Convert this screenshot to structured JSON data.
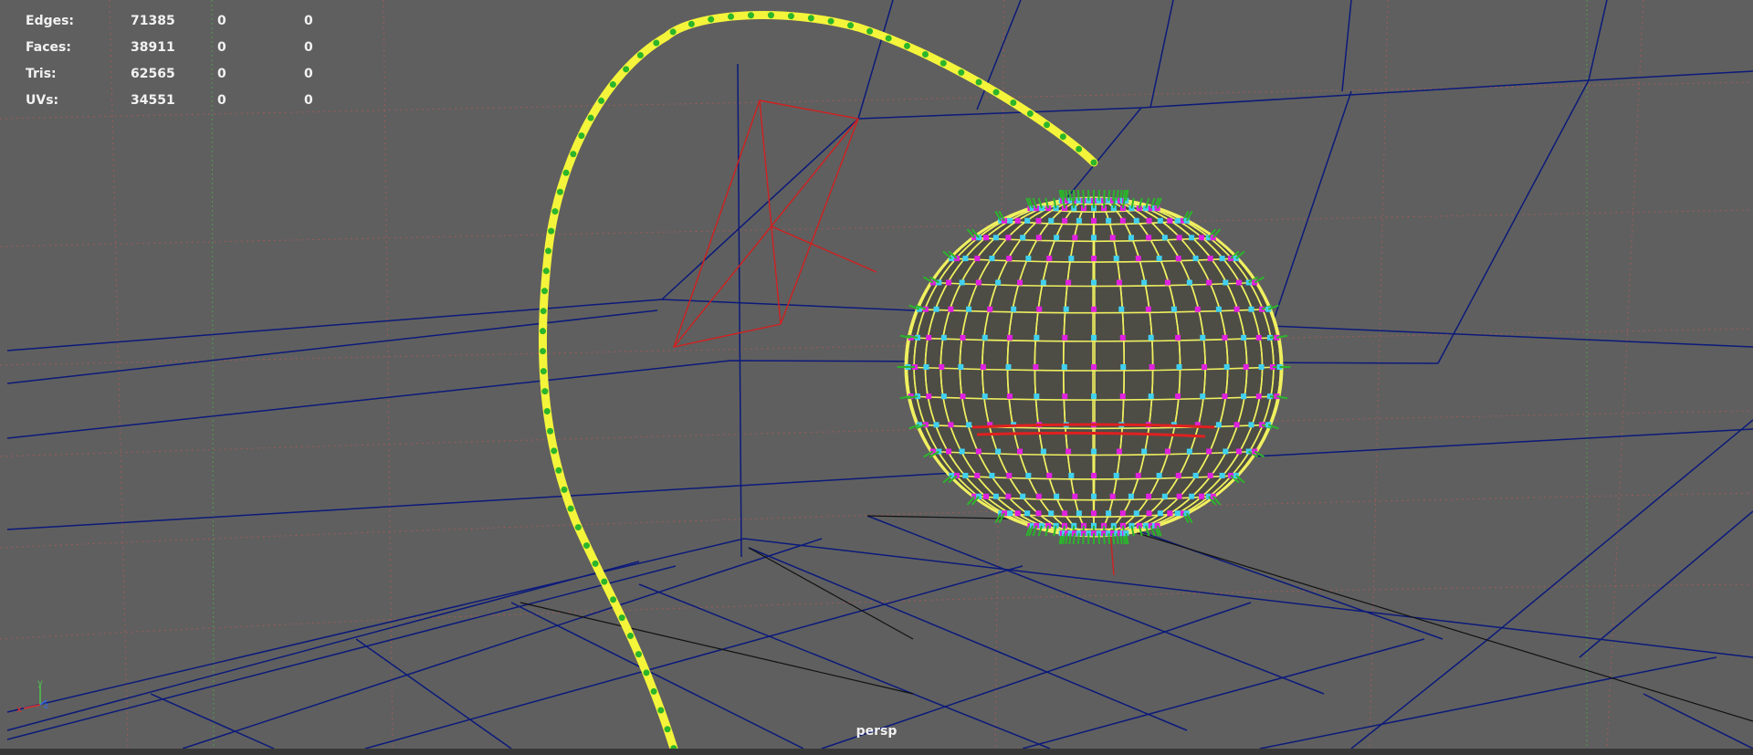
{
  "hud": {
    "rows": [
      {
        "label": "Edges:",
        "values": [
          "71385",
          "0",
          "0"
        ]
      },
      {
        "label": "Faces:",
        "values": [
          "38911",
          "0",
          "0"
        ]
      },
      {
        "label": "Tris:",
        "values": [
          "62565",
          "0",
          "0"
        ]
      },
      {
        "label": "UVs:",
        "values": [
          "34551",
          "0",
          "0"
        ]
      }
    ]
  },
  "viewport": {
    "camera": "persp",
    "background": "#5f5f5f"
  },
  "axis_gizmo": {
    "x": "x",
    "y": "y",
    "z": "z"
  },
  "colors": {
    "curve": "#f4f43a",
    "cv_points": "#2bb52b",
    "grid_blue": "#0b1a7a",
    "grid_red_dotted": "#c06060",
    "grid_green_dotted": "#4f9a4f",
    "light_red": "#d02020",
    "sphere_wire": "#e8e85a",
    "sphere_magenta": "#e020e0",
    "sphere_cyan": "#40d0f0"
  }
}
